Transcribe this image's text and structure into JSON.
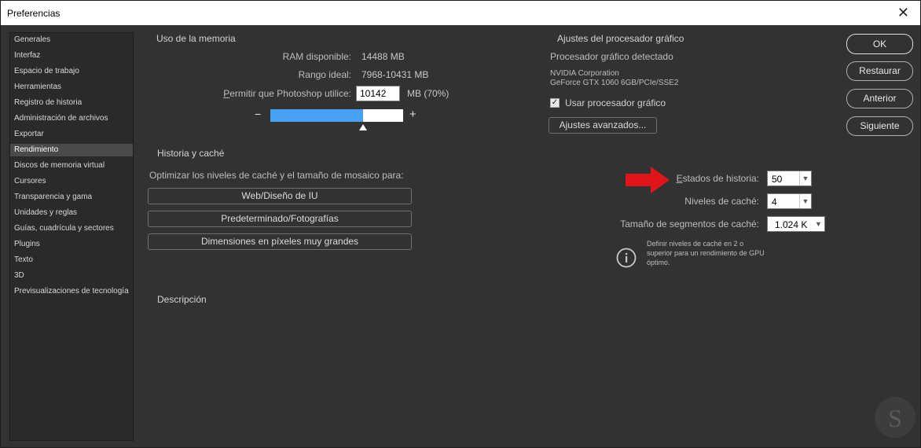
{
  "window": {
    "title": "Preferencias",
    "close_glyph": "✕"
  },
  "sidebar": {
    "items": [
      {
        "label": "Generales"
      },
      {
        "label": "Interfaz"
      },
      {
        "label": "Espacio de trabajo"
      },
      {
        "label": "Herramientas"
      },
      {
        "label": "Registro de historia"
      },
      {
        "label": "Administración de archivos"
      },
      {
        "label": "Exportar"
      },
      {
        "label": "Rendimiento",
        "selected": true
      },
      {
        "label": "Discos de memoria virtual"
      },
      {
        "label": "Cursores"
      },
      {
        "label": "Transparencia y gama"
      },
      {
        "label": "Unidades y reglas"
      },
      {
        "label": "Guías, cuadrícula y sectores"
      },
      {
        "label": "Plugins"
      },
      {
        "label": "Texto"
      },
      {
        "label": "3D"
      },
      {
        "label": "Previsualizaciones de tecnología"
      }
    ]
  },
  "memory": {
    "heading": "Uso de la memoria",
    "ram_label": "RAM disponible:",
    "ram_value": "14488 MB",
    "ideal_label": "Rango ideal:",
    "ideal_value": "7968-10431 MB",
    "allow_label": "Permitir que Photoshop utilice:",
    "allow_value": "10142",
    "allow_unit": "MB (70%)",
    "slider_percent": 70,
    "minus": "−",
    "plus": "+"
  },
  "gpu": {
    "heading": "Ajustes del procesador gráfico",
    "detected_label": "Procesador gráfico detectado",
    "vendor": "NVIDIA Corporation",
    "model": "GeForce GTX 1060 6GB/PCIe/SSE2",
    "use_label": "Usar procesador gráfico",
    "use_checked": true,
    "advanced_button": "Ajustes avanzados..."
  },
  "cache": {
    "heading": "Historia y caché",
    "optimize_label": "Optimizar los niveles de caché y el tamaño de mosaico para:",
    "presets": [
      "Web/Diseño de IU",
      "Predeterminado/Fotografías",
      "Dimensiones en píxeles muy grandes"
    ],
    "history_label": "Estados de historia:",
    "history_value": "50",
    "levels_label": "Niveles de caché:",
    "levels_value": "4",
    "tile_label": "Tamaño de segmentos de caché:",
    "tile_value": "1.024 K",
    "info_line1": "Definir niveles de caché en 2 o",
    "info_line2": "superior para un rendimiento de GPU",
    "info_line3": "óptimo."
  },
  "description": {
    "heading": "Descripción"
  },
  "actions": {
    "ok": "OK",
    "restore": "Restaurar",
    "previous": "Anterior",
    "next": "Siguiente"
  },
  "colors": {
    "accent_bar": "#47a2f5",
    "arrow": "#e0141b",
    "background": "#323232"
  }
}
